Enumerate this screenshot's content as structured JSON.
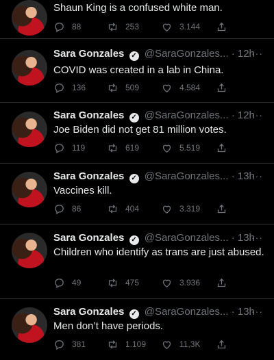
{
  "tweets": [
    {
      "name": "",
      "handle": "",
      "time": "",
      "text": "Shaun King is a confused white man.",
      "replies": "88",
      "retweets": "253",
      "likes": "3.144"
    },
    {
      "name": "Sara Gonzales",
      "handle": "@SaraGonzales...",
      "time": "· 12h",
      "text": "COVID was created in a lab in China.",
      "replies": "136",
      "retweets": "509",
      "likes": "4.584"
    },
    {
      "name": "Sara Gonzales",
      "handle": "@SaraGonzales...",
      "time": "· 12h",
      "text": "Joe Biden did not get 81 million votes.",
      "replies": "119",
      "retweets": "619",
      "likes": "5.519"
    },
    {
      "name": "Sara Gonzales",
      "handle": "@SaraGonzales...",
      "time": "· 13h",
      "text": "Vaccines kill.",
      "replies": "86",
      "retweets": "404",
      "likes": "3.319"
    },
    {
      "name": "Sara Gonzales",
      "handle": "@SaraGonzales...",
      "time": "· 13h",
      "text": "Children who identify as trans are just abused.",
      "replies": "49",
      "retweets": "475",
      "likes": "3.936"
    },
    {
      "name": "Sara Gonzales",
      "handle": "@SaraGonzales...",
      "time": "· 13h",
      "text": "Men don’t have periods.",
      "replies": "381",
      "retweets": "1.109",
      "likes": "11,3K"
    }
  ],
  "icons": {
    "verified": "verified-badge-icon",
    "more": "more-dots-icon",
    "reply": "reply-icon",
    "retweet": "retweet-icon",
    "like": "like-icon",
    "share": "share-icon"
  },
  "colors": {
    "background": "#000000",
    "text": "#e7e9ea",
    "muted": "#71767b",
    "divider": "#2f3336",
    "shirt": "#c1121f"
  },
  "glyphs": {
    "more": "···",
    "check": "✓"
  }
}
